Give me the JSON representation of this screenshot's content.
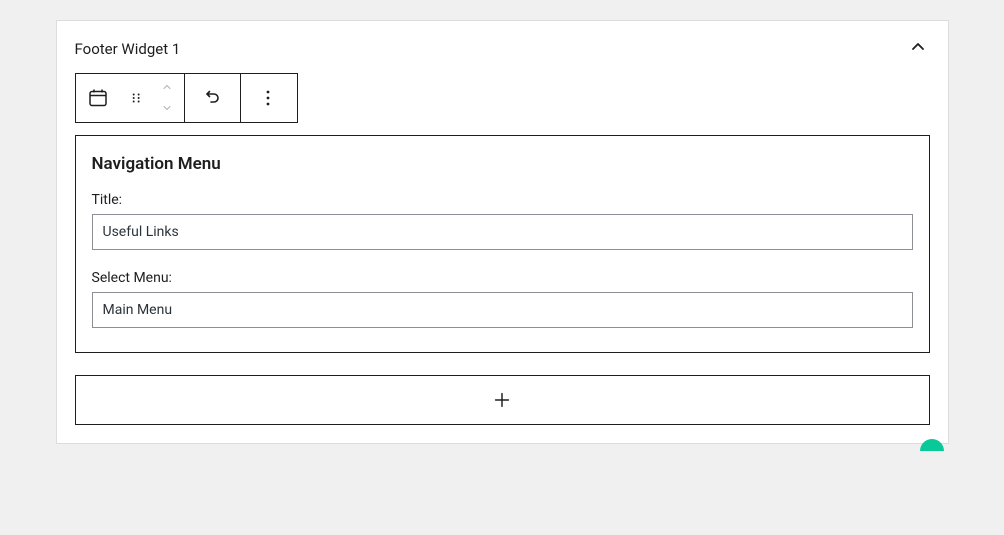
{
  "header": {
    "title": "Footer Widget 1"
  },
  "widget": {
    "name": "Navigation Menu",
    "fields": {
      "title_label": "Title:",
      "title_value": "Useful Links",
      "select_menu_label": "Select Menu:",
      "select_menu_value": "Main Menu"
    }
  }
}
